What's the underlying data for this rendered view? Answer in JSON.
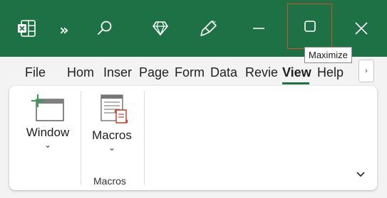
{
  "titlebar": {
    "app_icon": "excel-icon",
    "overflow_label": "»",
    "search_icon": "search-icon",
    "premium_icon": "diamond-icon",
    "design_icon": "brush-icon",
    "minimize_icon": "minimize-icon",
    "maximize_icon": "maximize-icon",
    "close_icon": "close-icon",
    "background": "#1e7145"
  },
  "tooltip": {
    "text": "Maximize"
  },
  "tabs": [
    {
      "label": "File"
    },
    {
      "label": "Hom"
    },
    {
      "label": "Inser"
    },
    {
      "label": "Page"
    },
    {
      "label": "Form"
    },
    {
      "label": "Data"
    },
    {
      "label": "Revie"
    },
    {
      "label": "View"
    },
    {
      "label": "Help"
    }
  ],
  "active_tab": "View",
  "tab_scroll_icon": "chevron-right-icon",
  "ribbon": {
    "window": {
      "label": "Window",
      "caret": "⌄"
    },
    "macros": {
      "label": "Macros",
      "caret": "⌄",
      "group_label": "Macros"
    },
    "collapse_icon": "chevron-down-icon"
  }
}
